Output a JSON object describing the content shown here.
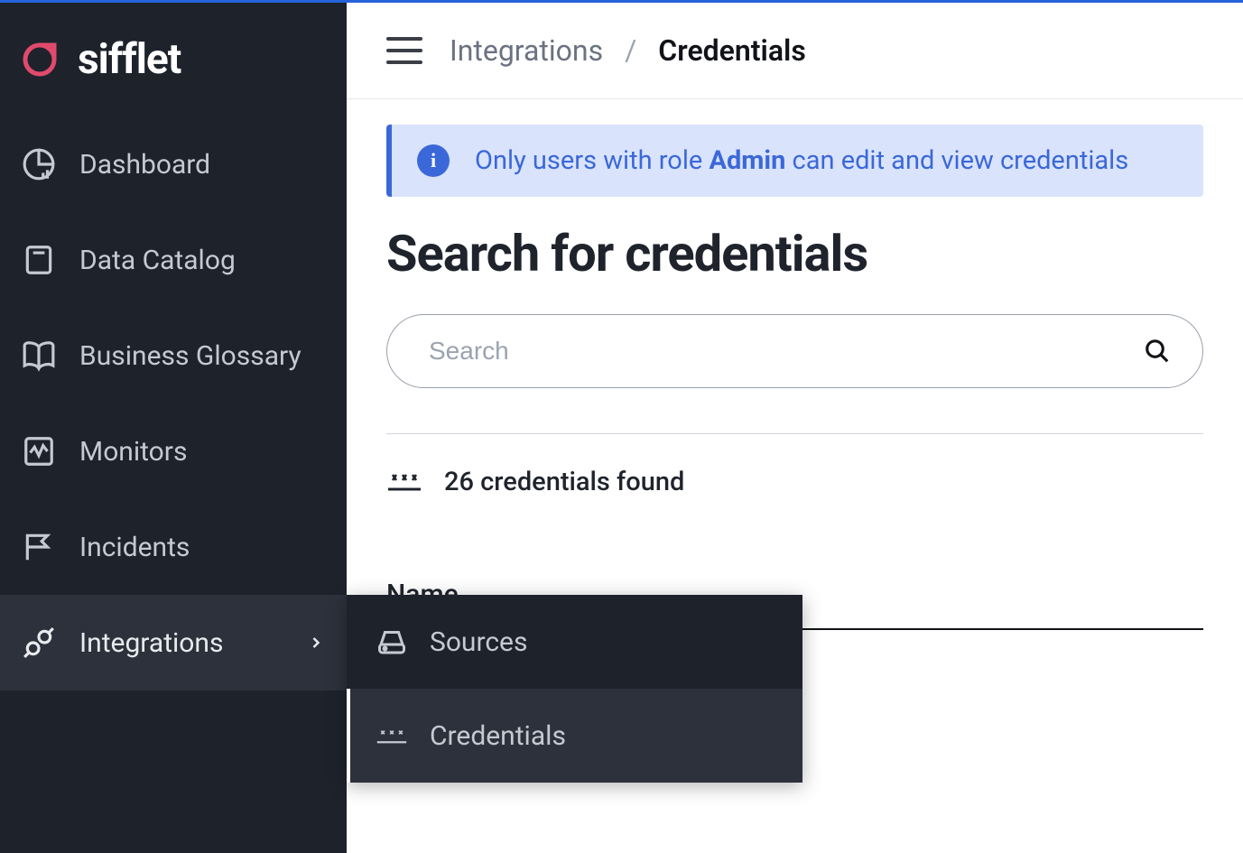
{
  "brand": {
    "name": "sifflet"
  },
  "sidebar": {
    "items": [
      {
        "label": "Dashboard"
      },
      {
        "label": "Data Catalog"
      },
      {
        "label": "Business Glossary"
      },
      {
        "label": "Monitors"
      },
      {
        "label": "Incidents"
      },
      {
        "label": "Integrations"
      }
    ]
  },
  "submenu": {
    "items": [
      {
        "label": "Sources"
      },
      {
        "label": "Credentials"
      }
    ]
  },
  "breadcrumb": {
    "parent": "Integrations",
    "current": "Credentials"
  },
  "alert": {
    "prefix": "Only users with role ",
    "role": "Admin",
    "suffix": " can edit and view credentials"
  },
  "page": {
    "title": "Search for credentials"
  },
  "search": {
    "placeholder": "Search",
    "value": ""
  },
  "results": {
    "count_text": "26 credentials found"
  },
  "table": {
    "columns": [
      "Name"
    ]
  }
}
